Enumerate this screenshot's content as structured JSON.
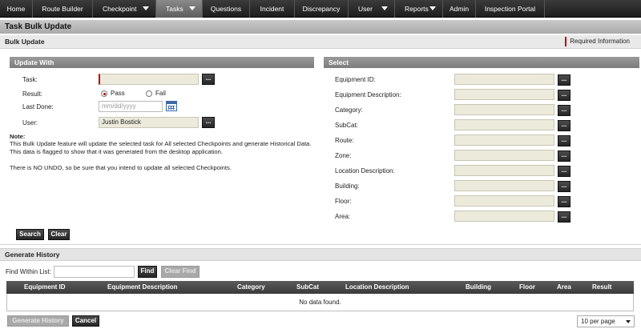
{
  "nav": {
    "items": [
      {
        "label": "Home"
      },
      {
        "label": "Route Builder"
      },
      {
        "label": "Checkpoint"
      },
      {
        "label": "Tasks"
      },
      {
        "label": "Questions"
      },
      {
        "label": "Incident"
      },
      {
        "label": "Discrepancy"
      },
      {
        "label": "User"
      },
      {
        "label": "Reports"
      },
      {
        "label": "Admin"
      },
      {
        "label": "Inspection Portal"
      }
    ]
  },
  "page": {
    "title": "Task Bulk Update",
    "subtitle": "Bulk Update",
    "required_info": "Required Information"
  },
  "update_with": {
    "header": "Update With",
    "task_label": "Task:",
    "task_value": "",
    "dots": "...",
    "result_label": "Result:",
    "result_options": [
      "Pass",
      "Fail"
    ],
    "result_selected": "Pass",
    "last_done_label": "Last Done:",
    "last_done_placeholder": "mm/dd/yyyy",
    "user_label": "User:",
    "user_value": "Justin Bostick",
    "note_title": "Note:",
    "note_text": "This Bulk Update feature will update the selected task for All selected Checkpoints and generate Historical Data. This data is flagged to show that it was generated from the desktop application.",
    "undo_text": "There is NO UNDO, so be sure that you intend to update all selected Checkpoints.",
    "search_btn": "Search",
    "clear_btn": "Clear"
  },
  "select": {
    "header": "Select",
    "fields": [
      {
        "label": "Equipment ID:"
      },
      {
        "label": "Equipment Description:"
      },
      {
        "label": "Category:"
      },
      {
        "label": "SubCat:"
      },
      {
        "label": "Route:"
      },
      {
        "label": "Zone:"
      },
      {
        "label": "Location Description:"
      },
      {
        "label": "Building:"
      },
      {
        "label": "Floor:"
      },
      {
        "label": "Area:"
      }
    ]
  },
  "history": {
    "header": "Generate History",
    "find_label": "Find Within List:",
    "find_value": "",
    "find_btn": "Find",
    "clear_find_btn": "Clear Find",
    "columns": [
      "Equipment ID",
      "Equipment Description",
      "Category",
      "SubCat",
      "Location Description",
      "Building",
      "Floor",
      "Area",
      "Result"
    ],
    "empty_text": "No data found.",
    "generate_btn": "Generate History",
    "cancel_btn": "Cancel",
    "per_page": "10 per page"
  }
}
